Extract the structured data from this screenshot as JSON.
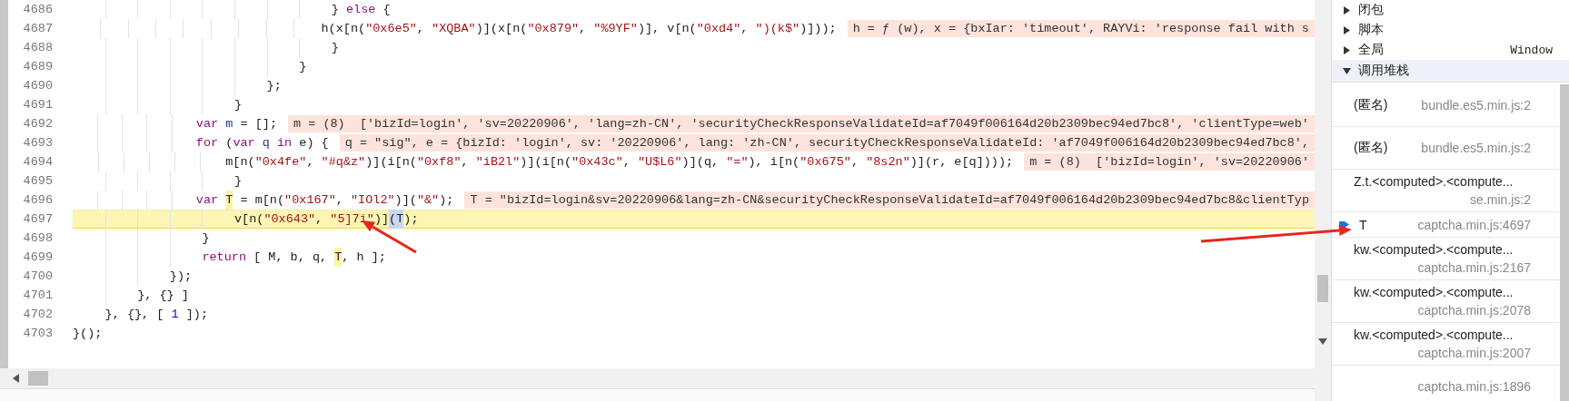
{
  "code": {
    "lines": [
      {
        "number": "4686",
        "current": false,
        "tokens": [
          {
            "kind": "plain",
            "text": "                                } "
          },
          {
            "kind": "kw",
            "text": "else"
          },
          {
            "kind": "plain",
            "text": " {"
          }
        ]
      },
      {
        "number": "4687",
        "current": false,
        "tokens": [
          {
            "kind": "plain",
            "text": "                                    h(x[n("
          },
          {
            "kind": "str",
            "text": "\"0x6e5\""
          },
          {
            "kind": "plain",
            "text": ", "
          },
          {
            "kind": "str",
            "text": "\"XQBA\""
          },
          {
            "kind": "plain",
            "text": ")](x[n("
          },
          {
            "kind": "str",
            "text": "\"0x879\""
          },
          {
            "kind": "plain",
            "text": ", "
          },
          {
            "kind": "str",
            "text": "\"%9YF\""
          },
          {
            "kind": "plain",
            "text": ")], v[n("
          },
          {
            "kind": "str",
            "text": "\"0xd4\""
          },
          {
            "kind": "plain",
            "text": ", "
          },
          {
            "kind": "str",
            "text": "\")(k$\""
          },
          {
            "kind": "plain",
            "text": ")]));"
          }
        ],
        "inline_value": "h = ƒ (w), x = {bxIar: 'timeout', RAYVi: 'response fail with s"
      },
      {
        "number": "4688",
        "current": false,
        "tokens": [
          {
            "kind": "plain",
            "text": "                                }"
          }
        ]
      },
      {
        "number": "4689",
        "current": false,
        "tokens": [
          {
            "kind": "plain",
            "text": "                            }"
          }
        ]
      },
      {
        "number": "4690",
        "current": false,
        "tokens": [
          {
            "kind": "plain",
            "text": "                        };"
          }
        ]
      },
      {
        "number": "4691",
        "current": false,
        "tokens": [
          {
            "kind": "plain",
            "text": "                    }"
          }
        ]
      },
      {
        "number": "4692",
        "current": false,
        "tokens": [
          {
            "kind": "kw",
            "text": "                    var"
          },
          {
            "kind": "def",
            "text": " m"
          },
          {
            "kind": "plain",
            "text": " = [];"
          }
        ],
        "inline_value": "m = (8)  ['bizId=login', 'sv=20220906', 'lang=zh-CN', 'securityCheckResponseValidateId=af7049f006164d20b2309bec94ed7bc8', 'clientType=web'"
      },
      {
        "number": "4693",
        "current": false,
        "tokens": [
          {
            "kind": "kw",
            "text": "                    for"
          },
          {
            "kind": "plain",
            "text": " ("
          },
          {
            "kind": "kw",
            "text": "var"
          },
          {
            "kind": "def",
            "text": " q"
          },
          {
            "kind": "kw",
            "text": " in"
          },
          {
            "kind": "plain",
            "text": " e) {"
          }
        ],
        "inline_value": "q = \"sig\", e = {bizId: 'login', sv: '20220906', lang: 'zh-CN', securityCheckResponseValidateId: 'af7049f006164d20b2309bec94ed7bc8',"
      },
      {
        "number": "4694",
        "current": false,
        "tokens": [
          {
            "kind": "plain",
            "text": "                        m[n("
          },
          {
            "kind": "str",
            "text": "\"0x4fe\""
          },
          {
            "kind": "plain",
            "text": ", "
          },
          {
            "kind": "str",
            "text": "\"#q&z\""
          },
          {
            "kind": "plain",
            "text": ")](i[n("
          },
          {
            "kind": "str",
            "text": "\"0xf8\""
          },
          {
            "kind": "plain",
            "text": ", "
          },
          {
            "kind": "str",
            "text": "\"iB2l\""
          },
          {
            "kind": "plain",
            "text": ")](i[n("
          },
          {
            "kind": "str",
            "text": "\"0x43c\""
          },
          {
            "kind": "plain",
            "text": ", "
          },
          {
            "kind": "str",
            "text": "\"U$L6\""
          },
          {
            "kind": "plain",
            "text": ")](q, "
          },
          {
            "kind": "str",
            "text": "\"=\""
          },
          {
            "kind": "plain",
            "text": "), i[n("
          },
          {
            "kind": "str",
            "text": "\"0x675\""
          },
          {
            "kind": "plain",
            "text": ", "
          },
          {
            "kind": "str",
            "text": "\"8s2n\""
          },
          {
            "kind": "plain",
            "text": ")](r, e[q])));"
          }
        ],
        "inline_value": "m = (8)  ['bizId=login', 'sv=20220906'"
      },
      {
        "number": "4695",
        "current": false,
        "tokens": [
          {
            "kind": "plain",
            "text": "                    }"
          }
        ]
      },
      {
        "number": "4696",
        "current": false,
        "tokens": [
          {
            "kind": "kw",
            "text": "                    var "
          },
          {
            "kind": "hl",
            "text": "T"
          },
          {
            "kind": "plain",
            "text": " = m[n("
          },
          {
            "kind": "str",
            "text": "\"0x167\""
          },
          {
            "kind": "plain",
            "text": ", "
          },
          {
            "kind": "str",
            "text": "\"IOl2\""
          },
          {
            "kind": "plain",
            "text": ")]("
          },
          {
            "kind": "str",
            "text": "\"&\""
          },
          {
            "kind": "plain",
            "text": ");"
          }
        ],
        "inline_value": "T = \"bizId=login&sv=20220906&lang=zh-CN&securityCheckResponseValidateId=af7049f006164d20b2309bec94ed7bc8&clientTyp"
      },
      {
        "number": "4697",
        "current": true,
        "tokens": [
          {
            "kind": "plain",
            "text": "                    v[n("
          },
          {
            "kind": "str",
            "text": "\"0x643\""
          },
          {
            "kind": "plain",
            "text": ", "
          },
          {
            "kind": "str",
            "text": "\"5]7i\""
          },
          {
            "kind": "plain",
            "text": ")]"
          },
          {
            "kind": "sel",
            "text": "(T"
          },
          {
            "kind": "plain",
            "text": ");"
          }
        ]
      },
      {
        "number": "4698",
        "current": false,
        "tokens": [
          {
            "kind": "plain",
            "text": "                }"
          }
        ]
      },
      {
        "number": "4699",
        "current": false,
        "tokens": [
          {
            "kind": "kw",
            "text": "                return"
          },
          {
            "kind": "plain",
            "text": " [ M, b, q, "
          },
          {
            "kind": "hl",
            "text": "T"
          },
          {
            "kind": "plain",
            "text": ", h ];"
          }
        ]
      },
      {
        "number": "4700",
        "current": false,
        "tokens": [
          {
            "kind": "plain",
            "text": "            });"
          }
        ]
      },
      {
        "number": "4701",
        "current": false,
        "tokens": [
          {
            "kind": "plain",
            "text": "        }, {} ]"
          }
        ]
      },
      {
        "number": "4702",
        "current": false,
        "tokens": [
          {
            "kind": "plain",
            "text": "    }, {}, [ "
          },
          {
            "kind": "num",
            "text": "1"
          },
          {
            "kind": "plain",
            "text": " ]);"
          }
        ]
      },
      {
        "number": "4703",
        "current": false,
        "tokens": [
          {
            "kind": "plain",
            "text": "}();"
          }
        ]
      }
    ]
  },
  "sidebar": {
    "sections": [
      {
        "kind": "scope",
        "label": "闭包",
        "expanded": false
      },
      {
        "kind": "scope",
        "label": "脚本",
        "expanded": false
      },
      {
        "kind": "scope",
        "label": "全局",
        "value": "Window",
        "expanded": false
      },
      {
        "kind": "header",
        "label": "调用堆栈",
        "expanded": true
      }
    ],
    "call_stack": [
      {
        "name": "(匿名)",
        "location": "bundle.es5.min.js:2",
        "current": false
      },
      {
        "name": "(匿名)",
        "location": "bundle.es5.min.js:2",
        "current": false
      },
      {
        "name": "Z.t.<computed>.<compute...",
        "location": "se.min.js:2",
        "current": false
      },
      {
        "name": "T",
        "location": "captcha.min.js:4697",
        "current": true
      },
      {
        "name": "kw.<computed>.<compute...",
        "location": "captcha.min.js:2167",
        "current": false
      },
      {
        "name": "kw.<computed>.<compute...",
        "location": "captcha.min.js:2078",
        "current": false
      },
      {
        "name": "kw.<computed>.<compute...",
        "location": "captcha.min.js:2007",
        "current": false
      },
      {
        "location": "captcha.min.js:1896",
        "current": false
      }
    ]
  },
  "markers": [
    {
      "kind": "arrow"
    },
    {
      "kind": "arrow"
    }
  ]
}
